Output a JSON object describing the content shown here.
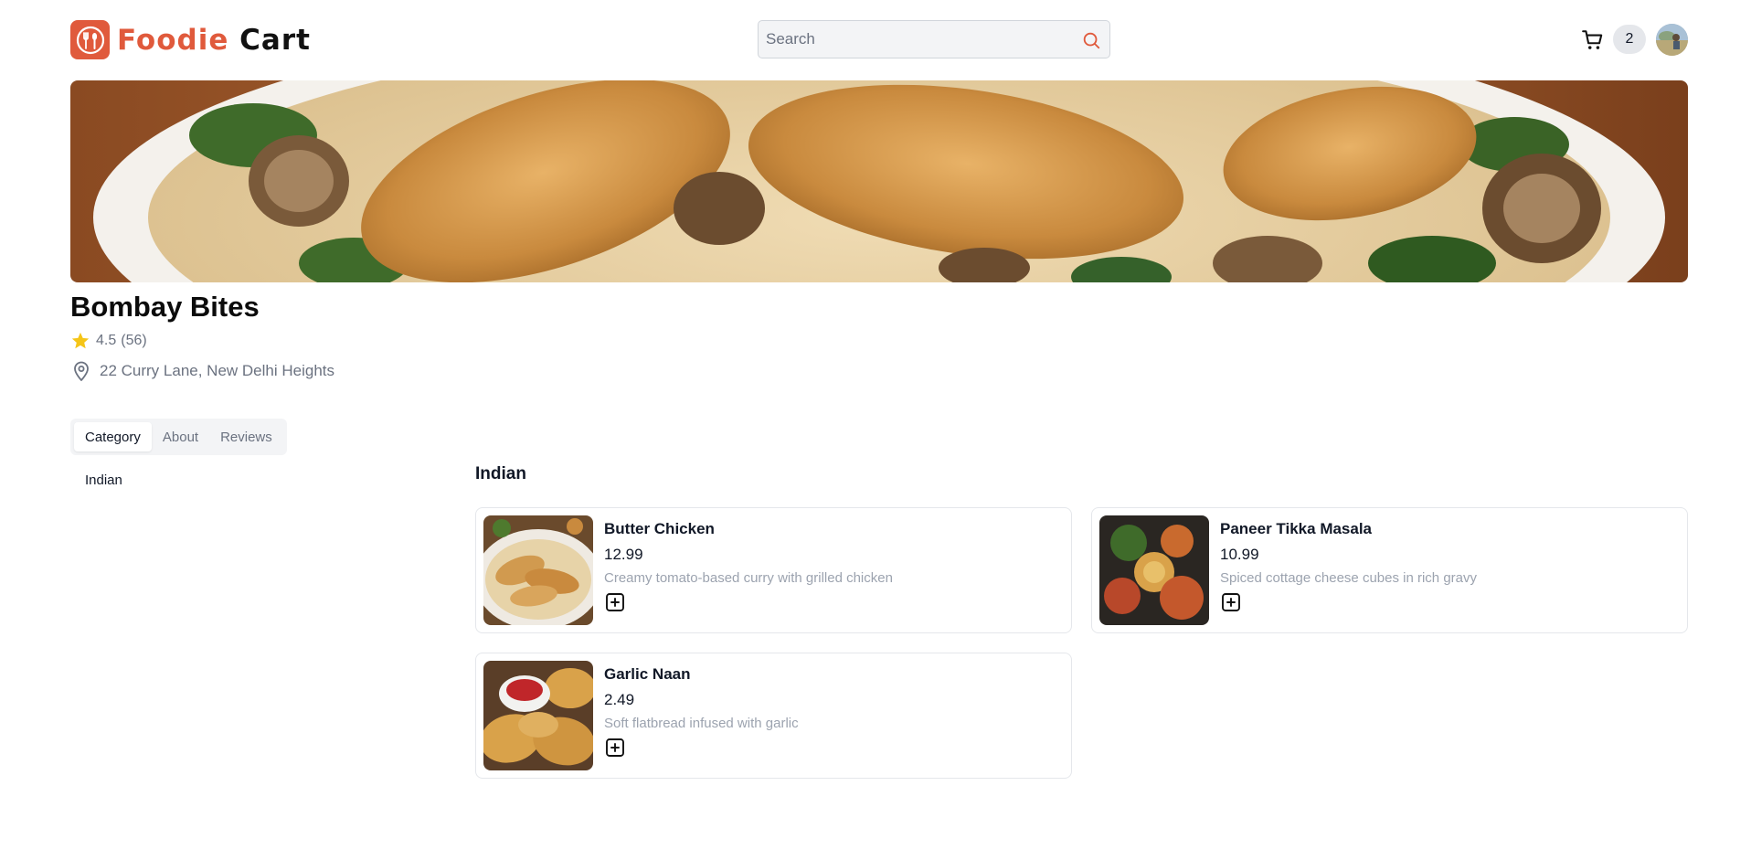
{
  "header": {
    "logo_word1": "Foodie",
    "logo_word2": "Cart",
    "search_placeholder": "Search",
    "cart_count": "2",
    "accent_color": "#e05a3c"
  },
  "restaurant": {
    "name": "Bombay Bites",
    "rating": "4.5",
    "review_count": "(56)",
    "address": "22 Curry Lane, New Delhi Heights"
  },
  "tabs": [
    {
      "label": "Category",
      "active": true
    },
    {
      "label": "About",
      "active": false
    },
    {
      "label": "Reviews",
      "active": false
    }
  ],
  "sidebar": {
    "categories": [
      "Indian"
    ]
  },
  "menu": {
    "section_title": "Indian",
    "items": [
      {
        "name": "Butter Chicken",
        "price": "12.99",
        "description": "Creamy tomato-based curry with grilled chicken",
        "icon": "plus-square-icon"
      },
      {
        "name": "Paneer Tikka Masala",
        "price": "10.99",
        "description": "Spiced cottage cheese cubes in rich gravy",
        "icon": "plus-square-icon"
      },
      {
        "name": "Garlic Naan",
        "price": "2.49",
        "description": "Soft flatbread infused with garlic",
        "icon": "plus-square-icon"
      }
    ]
  },
  "icons": {
    "search": "search-icon",
    "cart": "cart-icon",
    "rating": "star-icon",
    "address": "map-pin-icon"
  },
  "colors": {
    "star": "#f5c518",
    "muted_text": "#6b7280"
  }
}
